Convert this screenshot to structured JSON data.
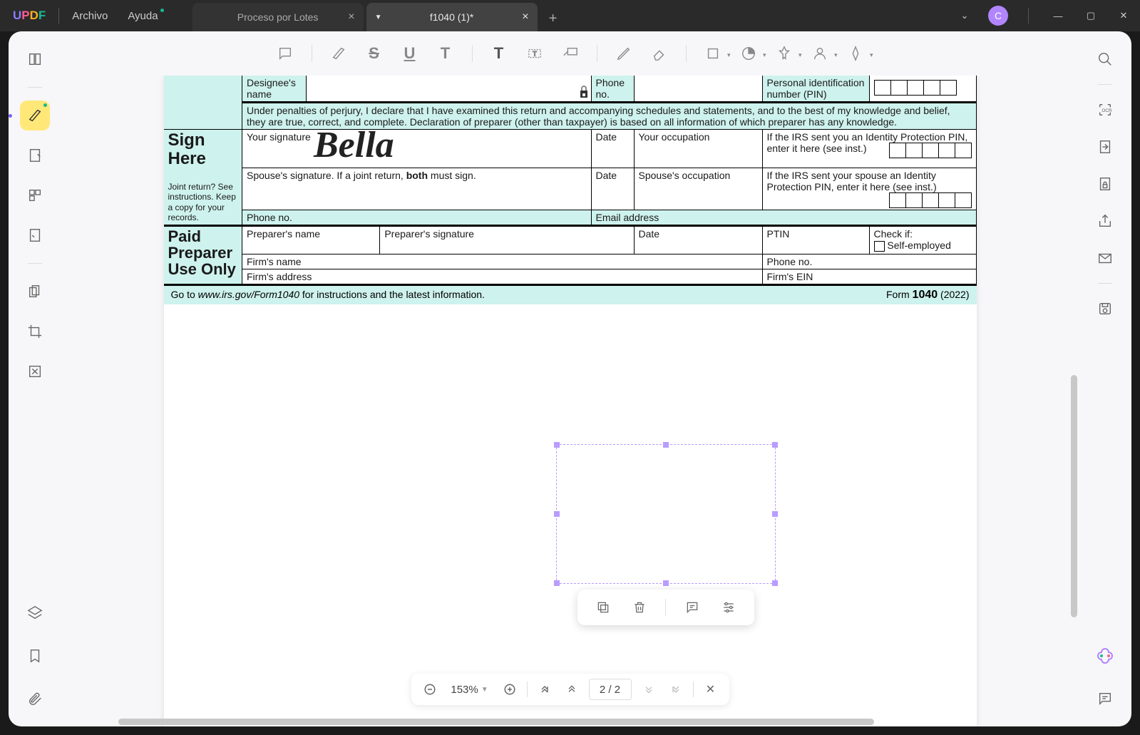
{
  "app": {
    "logo": {
      "u": "U",
      "p": "P",
      "d": "D",
      "f": "F"
    },
    "avatar": "C"
  },
  "menu": {
    "archivo": "Archivo",
    "ayuda": "Ayuda"
  },
  "tabs": {
    "t1": "Proceso por Lotes",
    "t2": "f1040 (1)*"
  },
  "form": {
    "designee_name": "Designee's name",
    "phone_no": "Phone no.",
    "pin_label": "Personal identification number (PIN)",
    "sign_here": "Sign Here",
    "declaration": "Under penalties of perjury, I declare that I have examined this return and accompanying schedules and statements, and to the best of my knowledge and belief, they are true, correct, and complete. Declaration of preparer (other than taxpayer) is based on all information of which preparer has any knowledge.",
    "your_sig": "Your signature",
    "date": "Date",
    "your_occ": "Your occupation",
    "irs_pin_you": "If the IRS sent you an Identity Protection PIN, enter it here (see inst.)",
    "joint": "Joint return? See instructions. Keep a copy for your records.",
    "spouse_sig_pre": "Spouse's signature. If a joint return, ",
    "spouse_sig_bold": "both",
    "spouse_sig_post": " must sign.",
    "spouse_occ": "Spouse's occupation",
    "irs_pin_spouse": "If the IRS sent your spouse an Identity Protection PIN, enter it here (see inst.)",
    "phone_no2": "Phone no.",
    "email": "Email address",
    "paid_preparer": "Paid Preparer Use Only",
    "preparer_name": "Preparer's name",
    "preparer_sig": "Preparer's signature",
    "ptin": "PTIN",
    "check_if": "Check if:",
    "self_employed": "Self-employed",
    "firm_name": "Firm's name",
    "firm_phone": "Phone no.",
    "firm_addr": "Firm's address",
    "firm_ein": "Firm's EIN",
    "footer_goto": "Go to ",
    "footer_url": "www.irs.gov/Form1040",
    "footer_instr": " for instructions and the latest information.",
    "footer_form": "Form ",
    "footer_1040": "1040",
    "footer_year": " (2022)",
    "signature_value": "Bella"
  },
  "pagenav": {
    "zoom": "153%",
    "page": "2 / 2"
  }
}
